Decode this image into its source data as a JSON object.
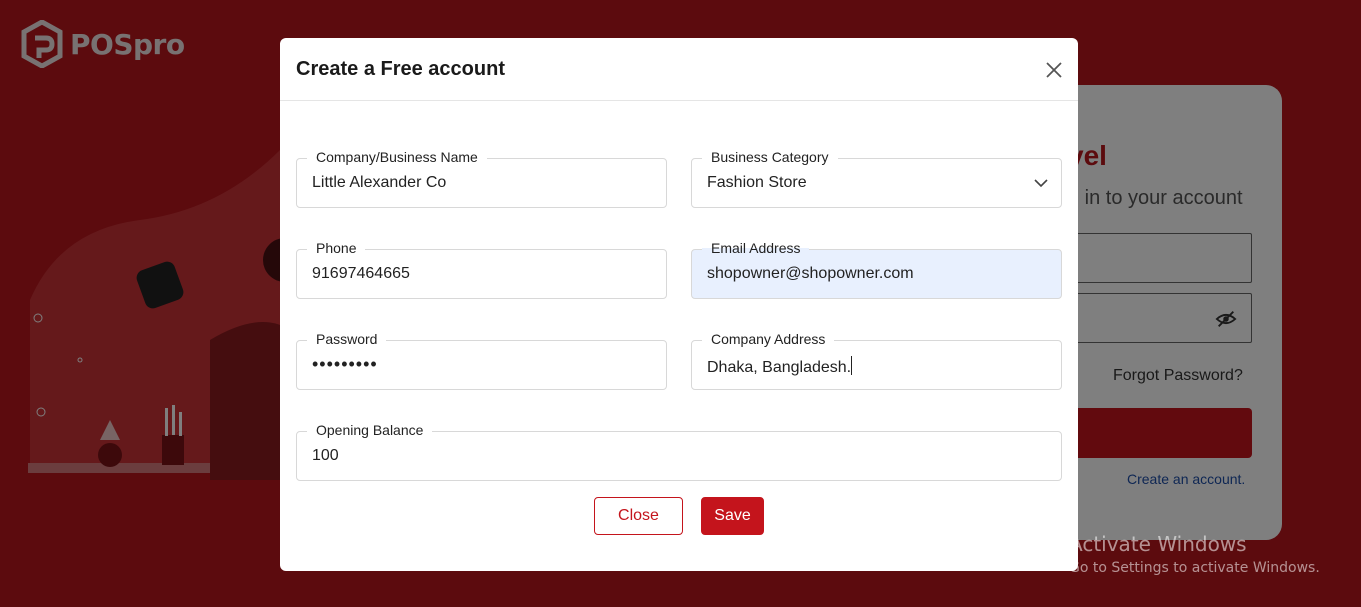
{
  "app": {
    "logo_text": "POSpro"
  },
  "login": {
    "title_partial": "vel",
    "subtitle_partial": "n in to your account",
    "forgot_password": "Forgot Password?",
    "create_account": "Create an account."
  },
  "modal": {
    "title": "Create a Free account",
    "fields": {
      "company_name": {
        "label": "Company/Business Name",
        "value": "Little Alexander Co"
      },
      "business_category": {
        "label": "Business Category",
        "value": "Fashion Store"
      },
      "phone": {
        "label": "Phone",
        "value": "91697464665"
      },
      "email": {
        "label": "Email Address",
        "value": "shopowner@shopowner.com"
      },
      "password": {
        "label": "Password",
        "value": "•••••••••"
      },
      "company_address": {
        "label": "Company Address",
        "value": "Dhaka, Bangladesh."
      },
      "opening_balance": {
        "label": "Opening Balance",
        "value": "100"
      }
    },
    "close_label": "Close",
    "save_label": "Save"
  },
  "watermark": {
    "title": "Activate Windows",
    "subtitle": "Go to Settings to activate Windows."
  },
  "colors": {
    "brand_red": "#c4141c",
    "autofill_blue": "#e8f0fe",
    "link_blue": "#1f4fa8"
  },
  "icons": [
    "logo-mark-icon",
    "close-icon",
    "chevron-down-icon",
    "eye-off-icon"
  ]
}
